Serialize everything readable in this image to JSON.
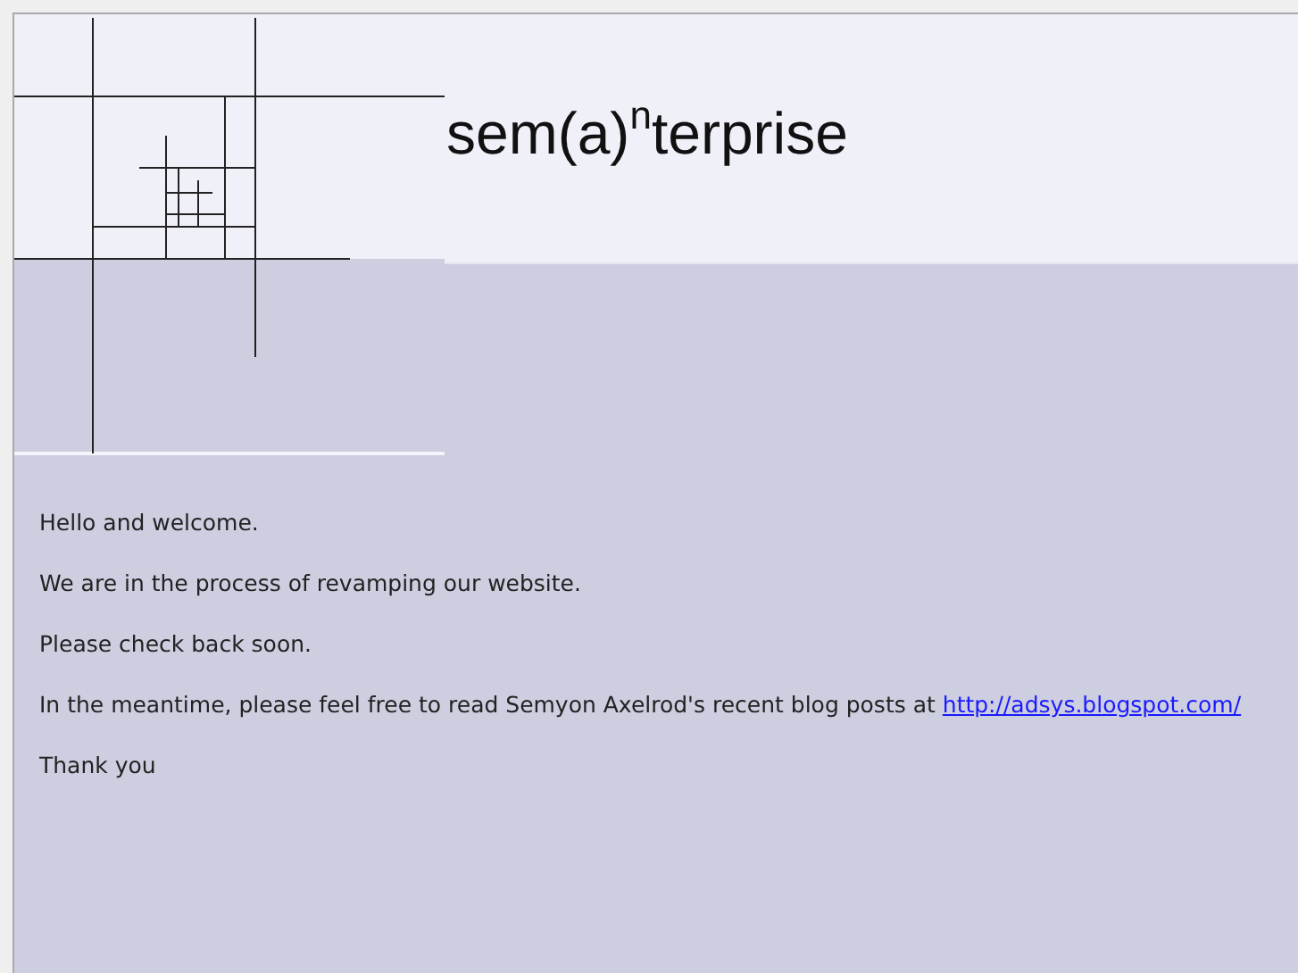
{
  "header": {
    "title": "sem(a)$^{n}$terprise"
  },
  "paragraphs": [
    {
      "kind": "text",
      "text": "Hello and welcome."
    },
    {
      "kind": "text",
      "text": "We are in the process of revamping our website."
    },
    {
      "kind": "text",
      "text": "Please check back soon."
    },
    {
      "kind": "link",
      "text": "In the meantime, please feel free to read Semyon Axelrod's recent blog posts at",
      "link": "http://adsys.blogspot.com/"
    },
    {
      "kind": "text",
      "text": "Thank you"
    }
  ]
}
